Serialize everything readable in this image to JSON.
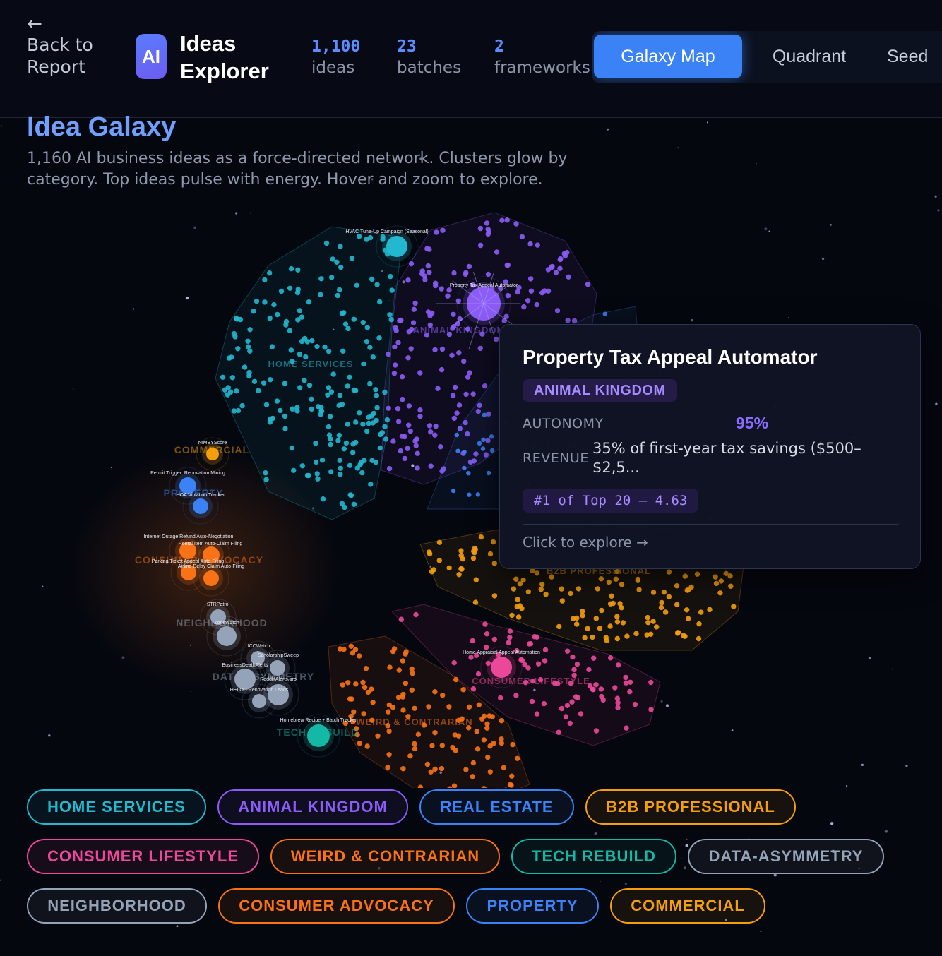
{
  "header": {
    "back_arrow": "←",
    "back_label": "Back to Report",
    "logo_text": "AI",
    "app_title": "Ideas Explorer",
    "stats": [
      {
        "value": "1,100",
        "label": "ideas"
      },
      {
        "value": "23",
        "label": "batches"
      },
      {
        "value": "2",
        "label": "frameworks"
      }
    ],
    "tabs": [
      "Galaxy Map",
      "Quadrant",
      "Seed"
    ],
    "active_tab": "Galaxy Map"
  },
  "intro": {
    "title": "Idea Galaxy",
    "description": "1,160 AI business ideas as a force-directed network. Clusters glow by category. Top ideas pulse with energy. Hover and zoom to explore."
  },
  "galaxy": {
    "clusters": [
      {
        "name": "HOME SERVICES",
        "color": "#22b8cf"
      },
      {
        "name": "ANIMAL KINGDOM",
        "color": "#8b5cf6"
      },
      {
        "name": "REAL ESTATE",
        "color": "#3b82f6"
      },
      {
        "name": "B2B PROFESSIONAL",
        "color": "#f59e0b"
      },
      {
        "name": "CONSUMER LIFESTYLE",
        "color": "#ec4899"
      },
      {
        "name": "WEIRD & CONTRARIAN",
        "color": "#f97316"
      },
      {
        "name": "TECH REBUILD",
        "color": "#14b8a6"
      },
      {
        "name": "DATA-ASYMMETRY",
        "color": "#94a3b8"
      },
      {
        "name": "NEIGHBORHOOD",
        "color": "#94a3b8"
      },
      {
        "name": "CONSUMER ADVOCACY",
        "color": "#f97316"
      },
      {
        "name": "PROPERTY",
        "color": "#3b82f6"
      },
      {
        "name": "COMMERCIAL",
        "color": "#f59e0b"
      }
    ],
    "node_labels": [
      "HVAC Tune-Up Campaign (Seasonal)",
      "Property Tax Appeal Automator",
      "NIMBYScore",
      "Permit Trigger: Renovation Mining",
      "HOA Violation Tracker",
      "Internet Outage Refund Auto-Negotiation",
      "Rental Item Auto-Claim Filing",
      "Parking Ticket Appeal Auto-Filing",
      "Airline Delay Claim Auto-Filing",
      "STRPatrol",
      "ZoneWatch",
      "UCCWatch",
      "ScholarshipSweep",
      "BusinessDeathAlerts",
      "ReddlitAlerts.pro",
      "HELOC Renovation Leads",
      "Homebrew Recipe + Batch Tracker",
      "Home Appraisal Appeal Automation"
    ]
  },
  "tooltip": {
    "title": "Property Tax Appeal Automator",
    "category": "ANIMAL KINGDOM",
    "autonomy_label": "AUTONOMY",
    "autonomy_value": "95%",
    "revenue_label": "REVENUE",
    "revenue_value": "35% of first-year tax savings ($500–$2,5...",
    "rank": "#1 of Top 20 — 4.63",
    "cta": "Click to explore →"
  },
  "legend": [
    {
      "label": "HOME SERVICES",
      "color": "#22b8cf"
    },
    {
      "label": "ANIMAL KINGDOM",
      "color": "#8b5cf6"
    },
    {
      "label": "REAL ESTATE",
      "color": "#3b82f6"
    },
    {
      "label": "B2B PROFESSIONAL",
      "color": "#f59e0b"
    },
    {
      "label": "CONSUMER LIFESTYLE",
      "color": "#ec4899"
    },
    {
      "label": "WEIRD & CONTRARIAN",
      "color": "#f97316"
    },
    {
      "label": "TECH REBUILD",
      "color": "#14b8a6"
    },
    {
      "label": "DATA-ASYMMETRY",
      "color": "#94a3b8"
    },
    {
      "label": "NEIGHBORHOOD",
      "color": "#94a3b8"
    },
    {
      "label": "CONSUMER ADVOCACY",
      "color": "#f97316"
    },
    {
      "label": "PROPERTY",
      "color": "#3b82f6"
    },
    {
      "label": "COMMERCIAL",
      "color": "#f59e0b"
    }
  ]
}
